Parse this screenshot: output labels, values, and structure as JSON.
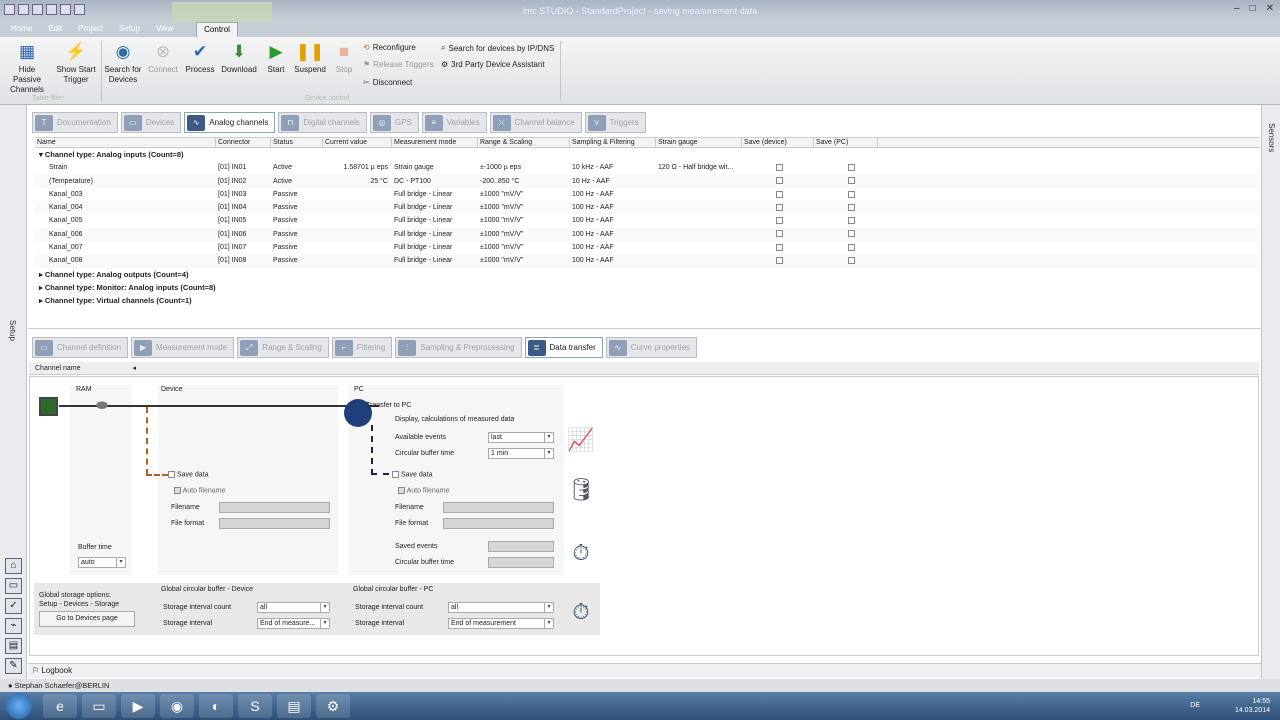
{
  "window": {
    "title": "imc STUDIO - StandardProject - saving measurement data",
    "minimize": "–",
    "maximize": "□",
    "close": "✕"
  },
  "menu_tabs": [
    "Home",
    "Edit",
    "Project",
    "Setup",
    "View",
    "Control"
  ],
  "ribbon": {
    "hide_passive": "Hide Passive Channels",
    "show_start": "Show Start Trigger",
    "table_filter": "Table filter",
    "search_devices": "Search for Devices",
    "connect": "Connect",
    "process": "Process",
    "download": "Download",
    "start": "Start",
    "suspend": "Suspend",
    "stop": "Stop",
    "reconfigure": "Reconfigure",
    "release_triggers": "Release Triggers",
    "disconnect": "Disconnect",
    "search_ip": "Search for devices by IP/DNS",
    "third_party": "3rd Party Device Assistant",
    "device_control": "Device control"
  },
  "top_tabs": [
    "Documentation",
    "Devices",
    "Analog channels",
    "Digital channels",
    "GPS",
    "Variables",
    "Channel balance",
    "Triggers"
  ],
  "grid": {
    "headers": [
      "Name",
      "Connector",
      "Status",
      "Current value",
      "Measurement mode",
      "Range & Scaling",
      "Sampling & Filtering",
      "Strain gauge",
      "Save (device)",
      "Save (PC)"
    ],
    "group_main": "Channel type: Analog inputs (Count=8)",
    "rows": [
      {
        "name": "Strain",
        "connector": "[01] IN01",
        "status": "Active",
        "value": "1.58701 µ eps",
        "mode": "Strain gauge",
        "range": "±-1000 µ eps",
        "sampling": "10 kHz - AAF",
        "strain": "120 Ω - Half bridge wit..."
      },
      {
        "name": "(Temperature)",
        "connector": "[01] IN02",
        "status": "Active",
        "value": "25 °C",
        "mode": "DC - PT100",
        "range": "-200..850 °C",
        "sampling": "10 Hz - AAF",
        "strain": ""
      },
      {
        "name": "Kanal_003",
        "connector": "[01] IN03",
        "status": "Passive",
        "value": "",
        "mode": "Full bridge - Linear",
        "range": "±1000 \"mV/V\"",
        "sampling": "100 Hz - AAF",
        "strain": ""
      },
      {
        "name": "Kanal_004",
        "connector": "[01] IN04",
        "status": "Passive",
        "value": "",
        "mode": "Full bridge - Linear",
        "range": "±1000 \"mV/V\"",
        "sampling": "100 Hz - AAF",
        "strain": ""
      },
      {
        "name": "Kanal_005",
        "connector": "[01] IN05",
        "status": "Passive",
        "value": "",
        "mode": "Full bridge - Linear",
        "range": "±1000 \"mV/V\"",
        "sampling": "100 Hz - AAF",
        "strain": ""
      },
      {
        "name": "Kanal_006",
        "connector": "[01] IN06",
        "status": "Passive",
        "value": "",
        "mode": "Full bridge - Linear",
        "range": "±1000 \"mV/V\"",
        "sampling": "100 Hz - AAF",
        "strain": ""
      },
      {
        "name": "Kanal_007",
        "connector": "[01] IN07",
        "status": "Passive",
        "value": "",
        "mode": "Full bridge - Linear",
        "range": "±1000 \"mV/V\"",
        "sampling": "100 Hz - AAF",
        "strain": ""
      },
      {
        "name": "Kanal_008",
        "connector": "[01] IN08",
        "status": "Passive",
        "value": "",
        "mode": "Full bridge - Linear",
        "range": "±1000 \"mV/V\"",
        "sampling": "100 Hz - AAF",
        "strain": ""
      }
    ],
    "groups_collapsed": [
      "Channel type: Analog outputs (Count=4)",
      "Channel type: Monitor: Analog inputs (Count=8)",
      "Channel type: Virtual channels (Count=1)"
    ]
  },
  "bottom_tabs": [
    "Channel definition",
    "Measurement mode",
    "Range & Scaling",
    "Filtering",
    "Sampling & Preprocessing",
    "Data transfer",
    "Curve properties"
  ],
  "detail": {
    "channel_name": "Channel name",
    "ram": "RAM",
    "device": "Device",
    "pc": "PC",
    "transfer_to_pc": "Transfer to PC",
    "display_calc": "Display, calculations of measured data",
    "available_events": "Available events",
    "available_events_val": "last",
    "circ_buffer_time": "Circular buffer time",
    "circ_buffer_time_val": "1 min",
    "save_data": "Save data",
    "auto_filename": "Auto filename",
    "filename": "Filename",
    "file_format": "File format",
    "saved_events": "Saved events",
    "buffer_time": "Buffer time",
    "buffer_time_val": "auto",
    "global_opts": "Global storage options: Setup - Devices - Storage",
    "goto_devices": "Go to Devices page",
    "gcb_device": "Global circular buffer - Device",
    "gcb_pc": "Global circular buffer - PC",
    "storage_interval_count": "Storage interval count",
    "storage_interval": "Storage interval",
    "sic_dev_val": "all",
    "si_dev_val": "End of measure...",
    "sic_pc_val": "all",
    "si_pc_val": "End of measurement"
  },
  "side": {
    "left": "Setup",
    "right": "Sensors"
  },
  "logbook": "Logbook",
  "status_user": "Stephan Schaefer@BERLIN",
  "tray": {
    "lang": "DE",
    "time": "14:55",
    "date": "14.03.2014"
  }
}
